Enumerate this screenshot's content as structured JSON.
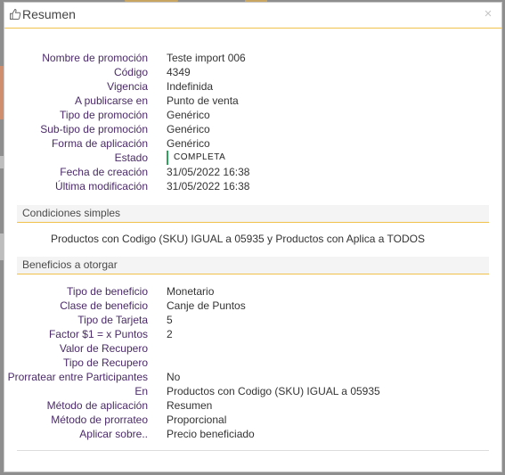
{
  "modal": {
    "title": "Resumen",
    "close_label": "×"
  },
  "summary": [
    {
      "label": "Nombre de promoción",
      "value": "Teste import 006"
    },
    {
      "label": "Código",
      "value": "4349"
    },
    {
      "label": "Vigencia",
      "value": "Indefinida"
    },
    {
      "label": "A publicarse en",
      "value": "Punto de venta"
    },
    {
      "label": "Tipo de promoción",
      "value": "Genérico"
    },
    {
      "label": "Sub-tipo de promoción",
      "value": "Genérico"
    },
    {
      "label": "Forma de aplicación",
      "value": "Genérico"
    },
    {
      "label": "Estado",
      "value": "COMPLETA"
    },
    {
      "label": "Fecha de creación",
      "value": "31/05/2022 16:38"
    },
    {
      "label": "Última modificación",
      "value": "31/05/2022 16:38"
    }
  ],
  "conditions": {
    "title": "Condiciones simples",
    "text": "Productos con Codigo (SKU) IGUAL a 05935 y Productos con Aplica a TODOS"
  },
  "benefits": {
    "title": "Beneficios a otorgar",
    "rows": [
      {
        "label": "Tipo de beneficio",
        "value": "Monetario"
      },
      {
        "label": "Clase de beneficio",
        "value": "Canje de Puntos"
      },
      {
        "label": "Tipo de Tarjeta",
        "value": "5"
      },
      {
        "label": "Factor $1 = x Puntos",
        "value": "2"
      },
      {
        "label": "Valor de Recupero",
        "value": ""
      },
      {
        "label": "Tipo de Recupero",
        "value": ""
      },
      {
        "label": "Prorratear entre Participantes",
        "value": "No"
      },
      {
        "label": "En",
        "value": "Productos con Codigo (SKU) IGUAL a 05935"
      },
      {
        "label": "Método de aplicación",
        "value": "Resumen"
      },
      {
        "label": "Método de prorrateo",
        "value": "Proporcional"
      },
      {
        "label": "Aplicar sobre..",
        "value": "Precio beneficiado"
      }
    ]
  },
  "colors": {
    "accent": "#f0c14b",
    "label": "#4a2a68",
    "status_bar": "#2ca35a"
  },
  "icons": {
    "title": "thumbs-up-icon",
    "close": "close-icon"
  }
}
